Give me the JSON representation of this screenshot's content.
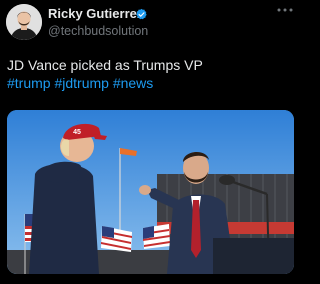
{
  "author": {
    "name": "Ricky Gutierrez",
    "handle": "@techbudsolution",
    "verified": true
  },
  "tweet": {
    "text": "JD Vance picked as Trumps VP",
    "hashtags": [
      "#trump",
      "#jdtrump",
      "#news"
    ]
  },
  "photo": {
    "hat_text": "45"
  },
  "icons": {
    "avatar": "profile-photo",
    "verified": "verified-badge-icon",
    "more": "more-options-icon"
  },
  "colors": {
    "background": "#000000",
    "text": "#e7e9ea",
    "muted": "#71767b",
    "accent": "#1d9bf0"
  }
}
